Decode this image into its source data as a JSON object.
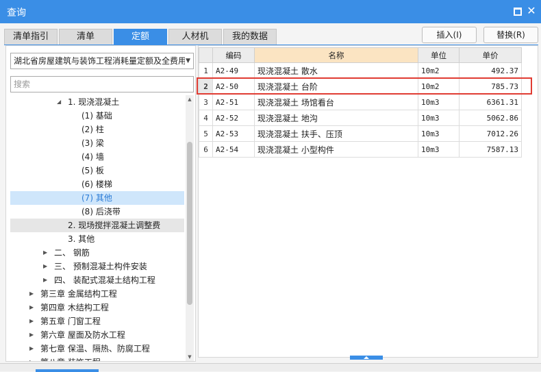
{
  "window": {
    "title": "查询",
    "close_glyph": "✕"
  },
  "tabs": [
    "清单指引",
    "清单",
    "定额",
    "人材机",
    "我的数据"
  ],
  "actions": {
    "insert": "插入(I)",
    "replace": "替换(R)"
  },
  "left_panel": {
    "dropdown_value": "湖北省房屋建筑与装饰工程消耗量定额及全费用",
    "search_placeholder": "搜索",
    "tree": [
      {
        "label": "1. 现浇混凝土",
        "expanded": true
      },
      {
        "label": "(1) 基础"
      },
      {
        "label": "(2) 柱"
      },
      {
        "label": "(3) 梁"
      },
      {
        "label": "(4) 墙"
      },
      {
        "label": "(5) 板"
      },
      {
        "label": "(6) 楼梯"
      },
      {
        "label": "(7) 其他",
        "selected": true
      },
      {
        "label": "(8) 后浇带"
      },
      {
        "label": "2. 现场搅拌混凝土调整费"
      },
      {
        "label": "3. 其他"
      },
      {
        "label": "二、 钢筋"
      },
      {
        "label": "三、 预制混凝土构件安装"
      },
      {
        "label": "四、 装配式混凝土结构工程"
      },
      {
        "label": "第三章 金属结构工程"
      },
      {
        "label": "第四章 木结构工程"
      },
      {
        "label": "第五章 门窗工程"
      },
      {
        "label": "第六章 屋面及防水工程"
      },
      {
        "label": "第七章 保温、隔热、防腐工程"
      },
      {
        "label": "第八章 装饰工程"
      }
    ]
  },
  "grid": {
    "columns": [
      "",
      "编码",
      "名称",
      "单位",
      "单价"
    ],
    "rows": [
      {
        "idx": "1",
        "code": "A2-49",
        "name": "现浇混凝土 散水",
        "unit": "10m2",
        "price": "492.37"
      },
      {
        "idx": "2",
        "code": "A2-50",
        "name": "现浇混凝土 台阶",
        "unit": "10m2",
        "price": "785.73"
      },
      {
        "idx": "3",
        "code": "A2-51",
        "name": "现浇混凝土 场馆看台",
        "unit": "10m3",
        "price": "6361.31"
      },
      {
        "idx": "4",
        "code": "A2-52",
        "name": "现浇混凝土 地沟",
        "unit": "10m3",
        "price": "5062.86"
      },
      {
        "idx": "5",
        "code": "A2-53",
        "name": "现浇混凝土 扶手、压顶",
        "unit": "10m3",
        "price": "7012.26"
      },
      {
        "idx": "6",
        "code": "A2-54",
        "name": "现浇混凝土 小型构件",
        "unit": "10m3",
        "price": "7587.13"
      }
    ],
    "highlighted_row": 1
  },
  "colors": {
    "accent": "#3a8ee6",
    "highlight_border": "#e03b32",
    "selected_bg": "#cfe6fb",
    "header_hl": "#fbe4c2"
  }
}
